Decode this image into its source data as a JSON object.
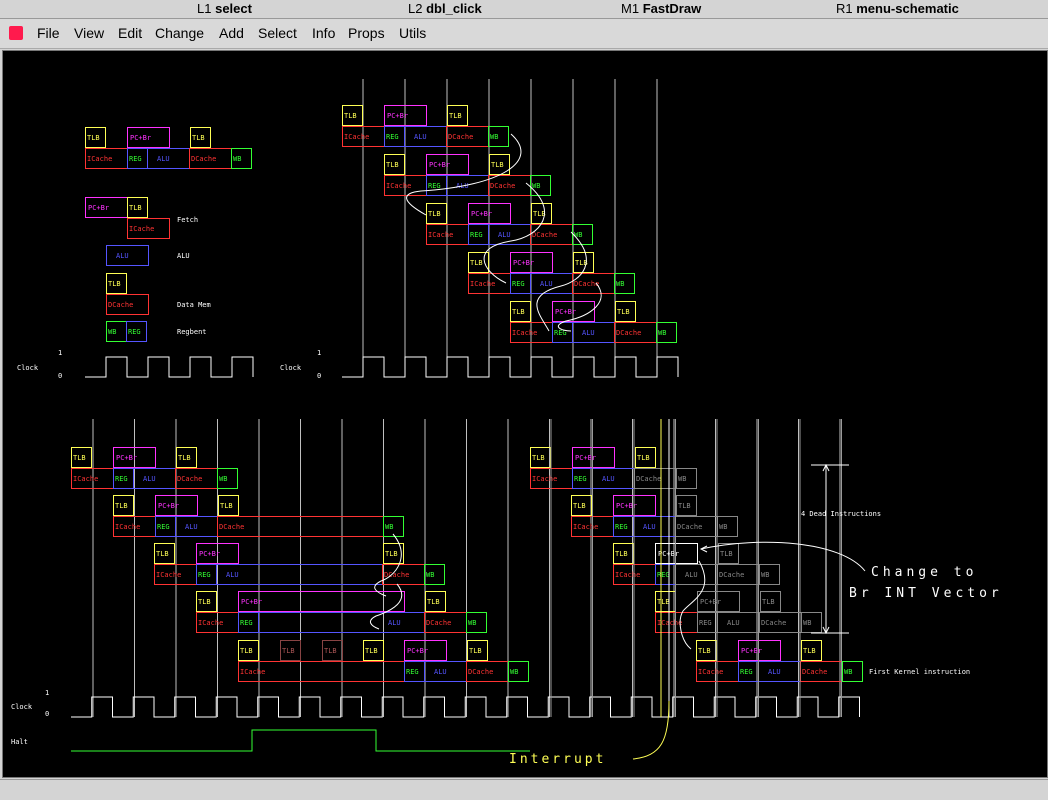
{
  "status": {
    "l1_key": "L1",
    "l1_val": "select",
    "l2_key": "L2",
    "l2_val": "dbl_click",
    "m1_key": "M1",
    "m1_val": "FastDraw",
    "r1_key": "R1",
    "r1_val": "menu-schematic"
  },
  "menu": [
    "File",
    "View",
    "Edit",
    "Change",
    "Add",
    "Select",
    "Info",
    "Props",
    "Utils"
  ],
  "colors": {
    "tlb": "#ffff55",
    "pc": "#ff33ff",
    "cache": "#ff3333",
    "alu": "#5555ff",
    "wb": "#33ff33",
    "gray": "#888888",
    "grid": "#bfbfbf",
    "annot": "#ffffff",
    "interrupt": "#ffff55"
  },
  "labels": {
    "tlb": "TLB",
    "pcbr": "PC+Br",
    "icache": "ICache",
    "reg": "REG",
    "alu": "ALU",
    "dcache": "DCache",
    "wb": "WB"
  },
  "legend": {
    "fetch": "Fetch",
    "alu": "ALU",
    "datamem": "Data Mem",
    "regwrite": "Regbent"
  },
  "clock": {
    "label": "Clock",
    "one": "1",
    "zero": "0"
  },
  "halt": "Halt",
  "interrupt": "Interrupt",
  "dead_instr": "4 Dead Instructions",
  "change_to": [
    "Change to",
    "Br INT Vector"
  ],
  "first_kernel": "First Kernel instruction"
}
